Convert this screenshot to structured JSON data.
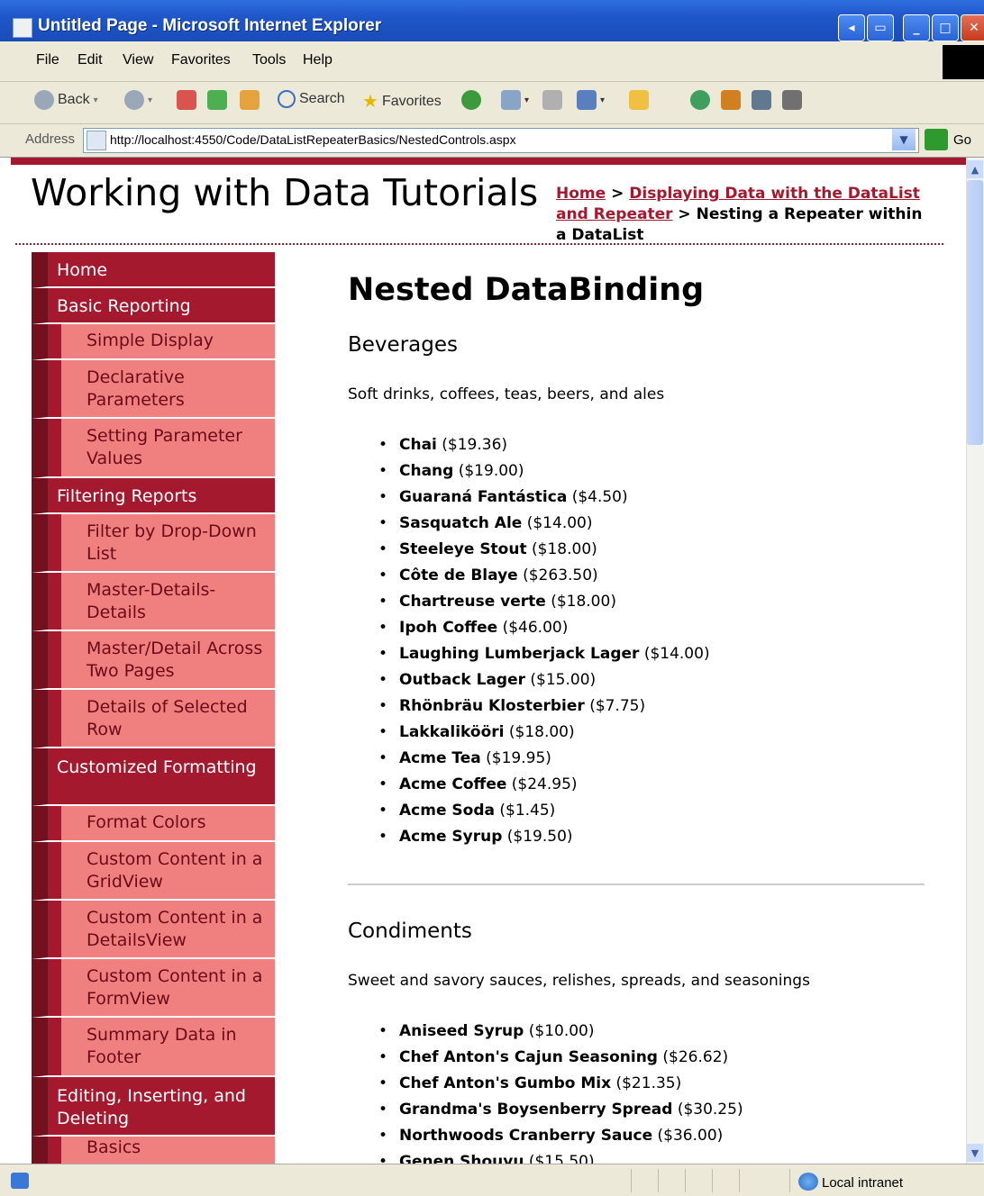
{
  "window": {
    "title": "Untitled Page - Microsoft Internet Explorer",
    "controls": [
      "minimize",
      "maximize",
      "close"
    ]
  },
  "menubar": [
    "File",
    "Edit",
    "View",
    "Favorites",
    "Tools",
    "Help"
  ],
  "toolbar": {
    "back_label": "Back",
    "search_label": "Search",
    "favorites_label": "Favorites"
  },
  "address": {
    "label": "Address",
    "url": "http://localhost:4550/Code/DataListRepeaterBasics/NestedControls.aspx",
    "go_label": "Go"
  },
  "header": {
    "site_title": "Working with Data Tutorials",
    "breadcrumb": {
      "home": "Home",
      "sep1": " > ",
      "section": "Displaying Data with the DataList and Repeater",
      "sep2": " > ",
      "current": "Nesting a Repeater within a DataList"
    }
  },
  "sidebar": {
    "items": [
      {
        "label": "Home",
        "level": 1
      },
      {
        "label": "Basic Reporting",
        "level": 1
      },
      {
        "label": "Simple Display",
        "level": 2
      },
      {
        "label": "Declarative Parameters",
        "level": 2
      },
      {
        "label": "Setting Parameter Values",
        "level": 2
      },
      {
        "label": "Filtering Reports",
        "level": 1
      },
      {
        "label": "Filter by Drop-Down List",
        "level": 2
      },
      {
        "label": "Master-Details-Details",
        "level": 2
      },
      {
        "label": "Master/Detail Across Two Pages",
        "level": 2
      },
      {
        "label": "Details of Selected Row",
        "level": 2
      },
      {
        "label": "Customized Formatting",
        "level": 1
      },
      {
        "label": "Format Colors",
        "level": 2
      },
      {
        "label": "Custom Content in a GridView",
        "level": 2
      },
      {
        "label": "Custom Content in a DetailsView",
        "level": 2
      },
      {
        "label": "Custom Content in a FormView",
        "level": 2
      },
      {
        "label": "Summary Data in Footer",
        "level": 2
      },
      {
        "label": "Editing, Inserting, and Deleting",
        "level": 1
      },
      {
        "label": "Basics",
        "level": 2
      }
    ]
  },
  "main": {
    "title": "Nested DataBinding",
    "categories": [
      {
        "name": "Beverages",
        "description": "Soft drinks, coffees, teas, beers, and ales",
        "products": [
          {
            "name": "Chai",
            "price": "($19.36)"
          },
          {
            "name": "Chang",
            "price": "($19.00)"
          },
          {
            "name": "Guaraná Fantástica",
            "price": "($4.50)"
          },
          {
            "name": "Sasquatch Ale",
            "price": "($14.00)"
          },
          {
            "name": "Steeleye Stout",
            "price": "($18.00)"
          },
          {
            "name": "Côte de Blaye",
            "price": "($263.50)"
          },
          {
            "name": "Chartreuse verte",
            "price": "($18.00)"
          },
          {
            "name": "Ipoh Coffee",
            "price": "($46.00)"
          },
          {
            "name": "Laughing Lumberjack Lager",
            "price": "($14.00)"
          },
          {
            "name": "Outback Lager",
            "price": "($15.00)"
          },
          {
            "name": "Rhönbräu Klosterbier",
            "price": "($7.75)"
          },
          {
            "name": "Lakkalikööri",
            "price": "($18.00)"
          },
          {
            "name": "Acme Tea",
            "price": "($19.95)"
          },
          {
            "name": "Acme Coffee",
            "price": "($24.95)"
          },
          {
            "name": "Acme Soda",
            "price": "($1.45)"
          },
          {
            "name": "Acme Syrup",
            "price": "($19.50)"
          }
        ]
      },
      {
        "name": "Condiments",
        "description": "Sweet and savory sauces, relishes, spreads, and seasonings",
        "products": [
          {
            "name": "Aniseed Syrup",
            "price": "($10.00)"
          },
          {
            "name": "Chef Anton's Cajun Seasoning",
            "price": "($26.62)"
          },
          {
            "name": "Chef Anton's Gumbo Mix",
            "price": "($21.35)"
          },
          {
            "name": "Grandma's Boysenberry Spread",
            "price": "($30.25)"
          },
          {
            "name": "Northwoods Cranberry Sauce",
            "price": "($36.00)"
          },
          {
            "name": "Genen Shouyu",
            "price": "($15.50)"
          }
        ]
      }
    ]
  },
  "statusbar": {
    "zone": "Local intranet"
  },
  "colors": {
    "accent": "#a5192f",
    "nav_sub": "#f08080",
    "nav_dark": "#73101f"
  }
}
